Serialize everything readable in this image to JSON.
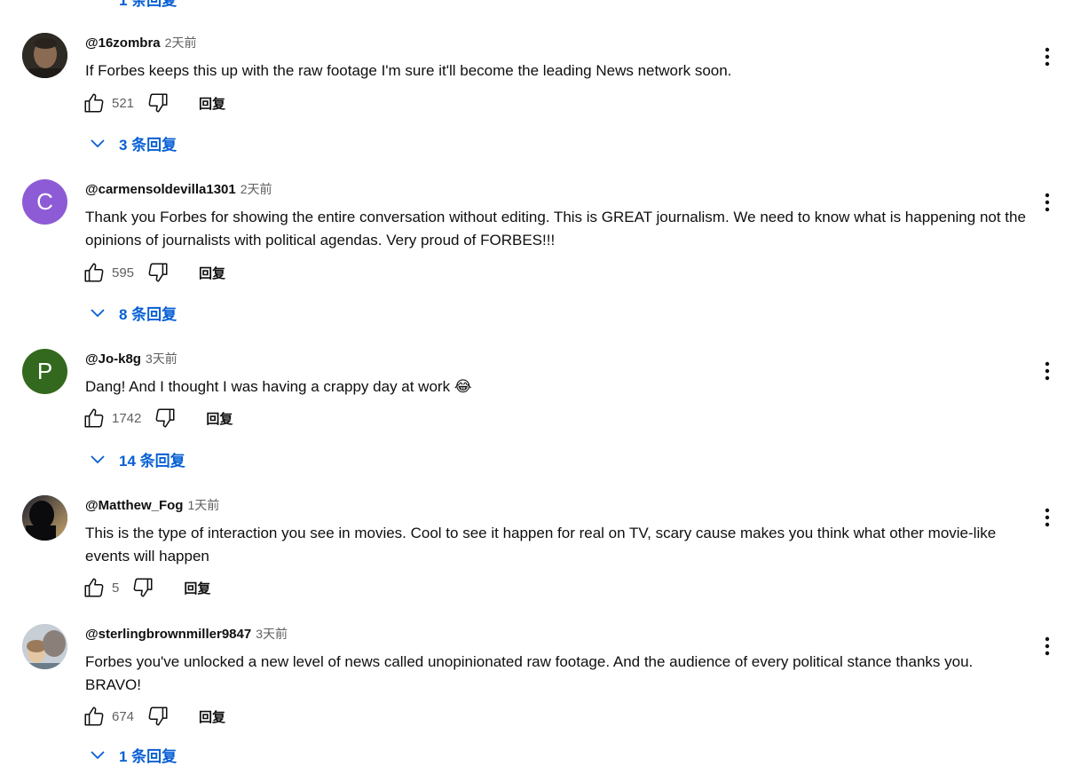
{
  "partial_top_replies": "1 条回复",
  "comments": [
    {
      "author": "@16zombra",
      "time": "2天前",
      "text": "If Forbes keeps this up with the raw footage I'm sure it'll become the leading News network soon.",
      "likes": "521",
      "reply_label": "回复",
      "replies_label": "3 条回复",
      "avatar": {
        "type": "photo",
        "bg": "#3a3228"
      }
    },
    {
      "author": "@carmensoldevilla1301",
      "time": "2天前",
      "text": "Thank you Forbes for showing the entire conversation without editing.  This is GREAT journalism.  We need to know what is happening not the opinions of journalists with political agendas.  Very proud of FORBES!!!",
      "likes": "595",
      "reply_label": "回复",
      "replies_label": "8 条回复",
      "avatar": {
        "type": "letter",
        "letter": "C",
        "bg": "#8e5bd6"
      }
    },
    {
      "author": "@Jo-k8g",
      "time": "3天前",
      "text": "Dang! And I thought I was having a crappy day at work 😂",
      "likes": "1742",
      "reply_label": "回复",
      "replies_label": "14 条回复",
      "avatar": {
        "type": "letter",
        "letter": "P",
        "bg": "#33691e"
      }
    },
    {
      "author": "@Matthew_Fog",
      "time": "1天前",
      "text": "This is the type of interaction you see in movies. Cool to see it happen for real on TV, scary cause makes you think what other movie-like events will happen",
      "likes": "5",
      "reply_label": "回复",
      "avatar": {
        "type": "photo",
        "bg": "#1a1a22"
      }
    },
    {
      "author": "@sterlingbrownmiller9847",
      "time": "3天前",
      "text": "Forbes you've unlocked a new level of news called unopinionated raw footage. And the audience of every political stance thanks you. BRAVO!",
      "likes": "674",
      "reply_label": "回复",
      "replies_label": "1 条回复",
      "avatar": {
        "type": "photo",
        "bg": "#b8c2cc"
      }
    }
  ],
  "colors": {
    "link": "#065fd4",
    "secondary_text": "#606060",
    "text": "#0f0f0f"
  }
}
